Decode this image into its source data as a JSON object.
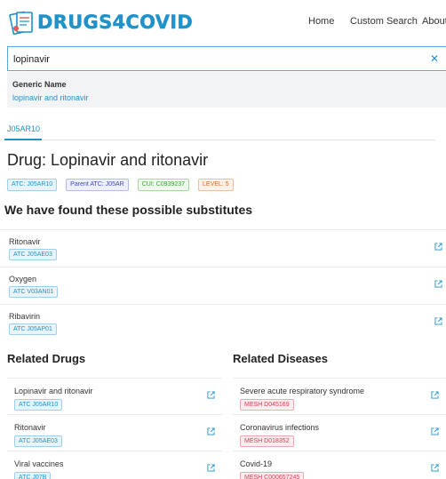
{
  "app": {
    "logo_text": "DRUGS4COVID",
    "brand_color": "#1f93c9"
  },
  "nav": {
    "home": "Home",
    "custom_search": "Custom Search",
    "about": "About"
  },
  "search": {
    "value": "lopinavir",
    "clear_icon": "close-icon"
  },
  "suggestions": {
    "heading": "Generic Name",
    "items": [
      "lopinavir and ritonavir"
    ]
  },
  "tabs": [
    {
      "label": "J05AR10",
      "active": true
    }
  ],
  "drug": {
    "title": "Drug: Lopinavir and ritonavir",
    "badges": {
      "atc": "ATC: J05AR10",
      "parent_atc": "Parent ATC: J05AR",
      "cui": "CUI: C0939237",
      "level": "LEVEL: 5"
    }
  },
  "substitutes": {
    "heading": "We have found these possible substitutes",
    "items": [
      {
        "name": "Ritonavir",
        "code": "ATC J05AE03"
      },
      {
        "name": "Oxygen",
        "code": "ATC V03AN01"
      },
      {
        "name": "Ribavirin",
        "code": "ATC J05AP01"
      }
    ]
  },
  "related_drugs": {
    "heading": "Related Drugs",
    "items": [
      {
        "name": "Lopinavir and ritonavir",
        "code": "ATC J05AR10"
      },
      {
        "name": "Ritonavir",
        "code": "ATC J05AE03"
      },
      {
        "name": "Viral vaccines",
        "code": "ATC J07B"
      }
    ]
  },
  "related_diseases": {
    "heading": "Related Diseases",
    "items": [
      {
        "name": "Severe acute respiratory syndrome",
        "code": "MESH D045169"
      },
      {
        "name": "Coronavirus infections",
        "code": "MESH D018352"
      },
      {
        "name": "Covid-19",
        "code": "MESH C000657245"
      }
    ]
  },
  "icons": {
    "external_link": "external-link-icon"
  }
}
